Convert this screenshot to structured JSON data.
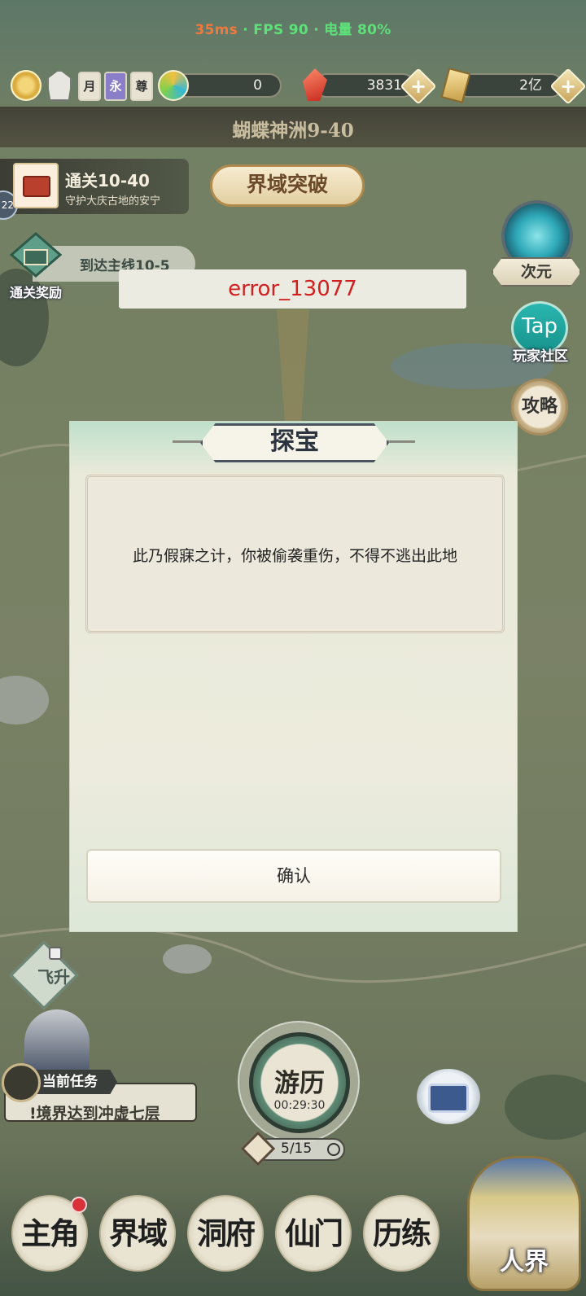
{
  "status": {
    "ping": "35ms",
    "fps": "FPS 90",
    "battery": "电量 80%"
  },
  "resources": {
    "card_icons": [
      "月",
      "永",
      "尊"
    ],
    "jade_value": "0",
    "gem_value": "3831",
    "scroll_value": "2亿"
  },
  "location": {
    "title": "蝴蝶神洲9-40"
  },
  "quest": {
    "title": "通关10-40",
    "desc": "守护大庆古地的安宁",
    "badge": "22"
  },
  "breakthrough_label": "界域突破",
  "reward": {
    "label": "通关奖励",
    "progress": "到达主线10-5"
  },
  "error_text": "error_13077",
  "right_menu": {
    "portal_label": "次元",
    "tap_icon": "Tap",
    "tap_label": "玩家社区",
    "guide_label": "攻略"
  },
  "modal": {
    "title": "探宝",
    "message": "此乃假寐之计，你被偷袭重伤，不得不逃出此地",
    "confirm": "确认"
  },
  "ascend_label": "飞升",
  "task": {
    "tag": "当前任务",
    "text": "!境界达到冲虚七层"
  },
  "journey": {
    "label": "游历",
    "timer": "00:29:30",
    "count": "5/15"
  },
  "nav": {
    "items": [
      "主角",
      "界域",
      "洞府",
      "仙门",
      "历练"
    ],
    "realm": "人界"
  },
  "colors": {
    "ping": "#f2793b",
    "perf": "#5ee07a",
    "error": "#d21f1f",
    "notify": "#d9303a"
  }
}
